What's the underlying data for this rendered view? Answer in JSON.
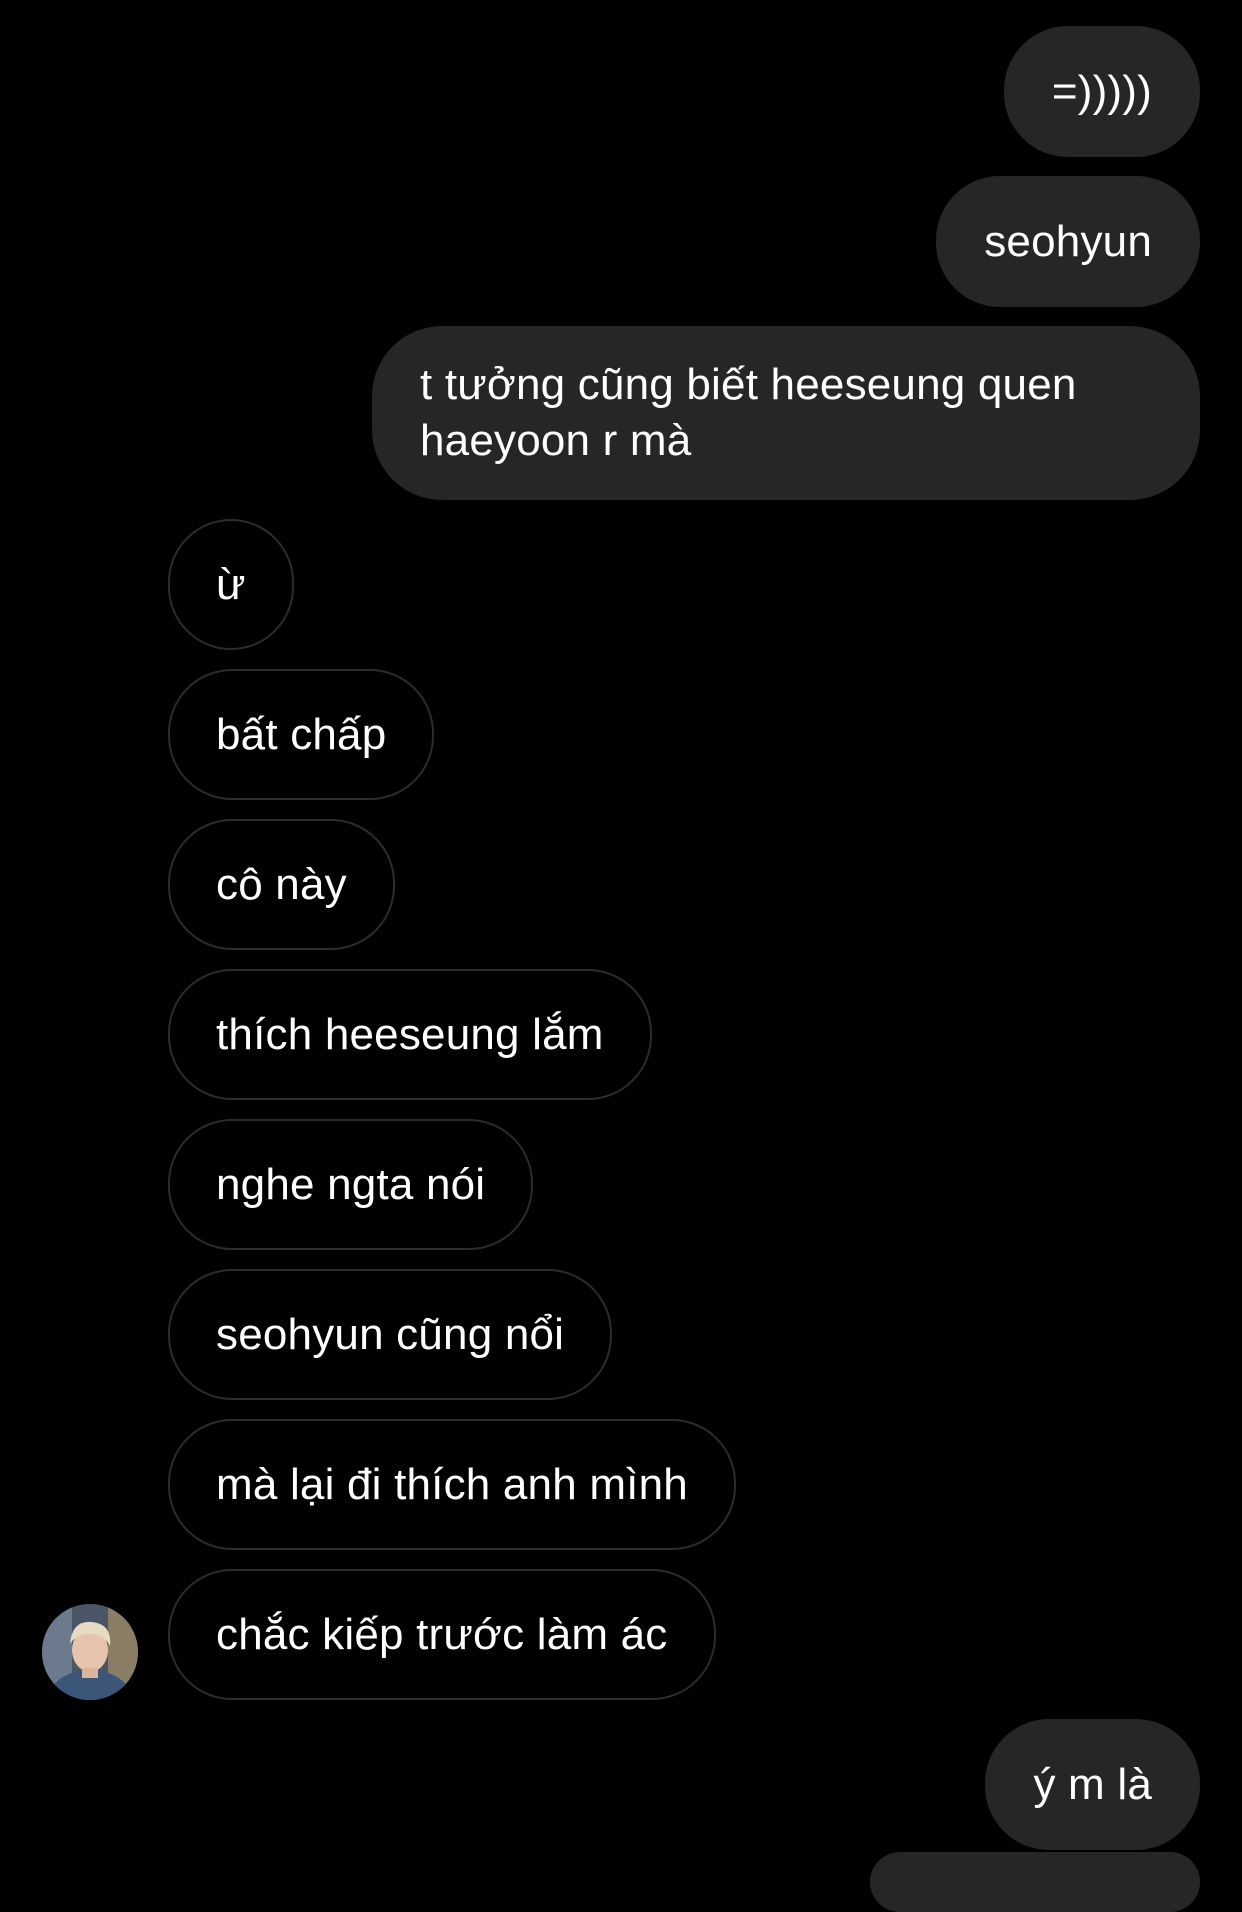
{
  "colors": {
    "background": "#000000",
    "sent_bubble": "#262626",
    "received_border": "#2c2c2c",
    "text": "#ffffff"
  },
  "messages": {
    "sent": [
      "=)))))",
      "seohyun",
      "t tưởng cũng biết heeseung quen haeyoon r mà"
    ],
    "received": [
      "ừ",
      "bất chấp",
      "cô này",
      "thích heeseung lắm",
      "nghe ngta nói",
      "seohyun cũng nổi",
      "mà lại đi thích anh mình",
      "chắc kiếp trước làm ác"
    ],
    "sent_after": [
      "ý m là"
    ]
  },
  "avatar": {
    "icon": "profile-photo"
  }
}
